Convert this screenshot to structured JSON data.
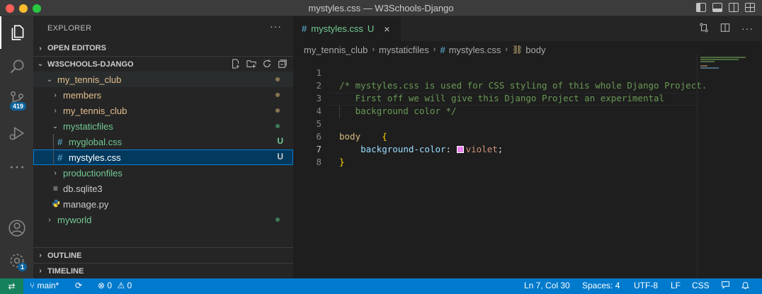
{
  "window": {
    "title": "mystyles.css — W3Schools-Django"
  },
  "activity": {
    "scm_badge": "419",
    "settings_badge": "1"
  },
  "explorer": {
    "header": "EXPLORER",
    "more": "···",
    "open_editors": "OPEN EDITORS",
    "folder": "W3SCHOOLS-DJANGO",
    "tree": [
      {
        "label": "my_tennis_club",
        "status": "",
        "type": "folder-open"
      },
      {
        "label": "members",
        "status": "",
        "type": "folder"
      },
      {
        "label": "my_tennis_club",
        "status": "",
        "type": "folder"
      },
      {
        "label": "mystaticfiles",
        "status": "",
        "type": "folder-open"
      },
      {
        "label": "myglobal.css",
        "status": "U",
        "type": "css"
      },
      {
        "label": "mystyles.css",
        "status": "U",
        "type": "css"
      },
      {
        "label": "productionfiles",
        "status": "",
        "type": "folder"
      },
      {
        "label": "db.sqlite3",
        "status": "",
        "type": "db"
      },
      {
        "label": "manage.py",
        "status": "",
        "type": "py"
      },
      {
        "label": "myworld",
        "status": "",
        "type": "folder"
      }
    ],
    "outline": "OUTLINE",
    "timeline": "TIMELINE"
  },
  "editor": {
    "tab": {
      "name": "mystyles.css",
      "status": "U",
      "close": "×"
    },
    "breadcrumb": [
      "my_tennis_club",
      "mystaticfiles",
      "mystyles.css",
      "body"
    ],
    "lines": {
      "n1": "1",
      "n2": "2",
      "n3": "3",
      "n4": "4",
      "n5": "5",
      "n6": "6",
      "n7": "7",
      "n8": "8",
      "l2": "/* mystyles.css is used for CSS styling of this whole Django Project.",
      "l3": "   First off we will give this Django Project an experimental",
      "l4": "   background color */",
      "l6_sel": "body",
      "l6_brace": "{",
      "l7_prop": "background-color",
      "l7_colon": ": ",
      "l7_val": "violet",
      "l7_semi": ";",
      "l8_brace": "}"
    },
    "swatch_color": "#ee82ee"
  },
  "status": {
    "branch": "main*",
    "errors": "0",
    "warnings": "0",
    "position": "Ln 7, Col 30",
    "spaces": "Spaces: 4",
    "encoding": "UTF-8",
    "eol": "LF",
    "language": "CSS"
  }
}
